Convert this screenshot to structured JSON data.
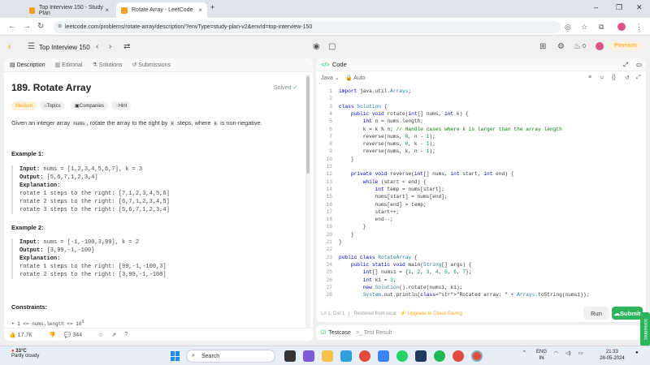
{
  "browser": {
    "tabs": [
      {
        "title": "Top Interview 150 - Study Plan",
        "close": "×"
      },
      {
        "title": "Rotate Array - LeetCode",
        "close": "×"
      }
    ],
    "new_tab": "+",
    "window_controls": [
      "–",
      "❐",
      "✕"
    ],
    "url": "leetcode.com/problems/rotate-array/description/?envType=study-plan-v2&envId=top-interview-150"
  },
  "lc_header": {
    "study_plan": "Top Interview 150",
    "streak": "0",
    "premium": "Premium"
  },
  "left_tabs": [
    {
      "label": "Description"
    },
    {
      "label": "Editorial"
    },
    {
      "label": "Solutions"
    },
    {
      "label": "Submissions"
    }
  ],
  "problem": {
    "title": "189. Rotate Array",
    "status": "Solved",
    "chips": [
      "Medium",
      "Topics",
      "Companies",
      "Hint"
    ],
    "desc_1": "Given an integer array ",
    "desc_nums": "nums",
    "desc_2": ", rotate the array to the right by ",
    "desc_k": "k",
    "desc_3": " steps, where ",
    "desc_k2": "k",
    "desc_4": " is non-negative."
  },
  "examples": [
    {
      "heading": "Example 1:",
      "input_label": "Input:",
      "input": " nums = [1,2,3,4,5,6,7], k = 3",
      "output_label": "Output:",
      "output": " [5,6,7,1,2,3,4]",
      "explanation_label": "Explanation:",
      "lines": [
        "rotate 1 steps to the right: [7,1,2,3,4,5,6]",
        "rotate 2 steps to the right: [6,7,1,2,3,4,5]",
        "rotate 3 steps to the right: [5,6,7,1,2,3,4]"
      ]
    },
    {
      "heading": "Example 2:",
      "input_label": "Input:",
      "input": " nums = [-1,-100,3,99], k = 2",
      "output_label": "Output:",
      "output": " [3,99,-1,-100]",
      "explanation_label": "Explanation:",
      "lines": [
        "rotate 1 steps to the right: [99,-1,-100,3]",
        "rotate 2 steps to the right: [3,99,-1,-100]"
      ]
    }
  ],
  "constraints": {
    "heading": "Constraints:",
    "first": "1 <= nums.length <= 10",
    "first_sup": "5"
  },
  "left_footer": {
    "likes": "17.7K",
    "comments": "344"
  },
  "code_panel": {
    "title": "Code",
    "language": "Java",
    "auto": "Auto",
    "cursor": "Ln 1, Col 1",
    "restored": "Restored from local",
    "upgrade": "Upgrade to Cloud Saving",
    "run": "Run",
    "submit": "Submit"
  },
  "code_lines": [
    "import java.util.Arrays;",
    "",
    "class Solution {",
    "    public void rotate(int[] nums, int k) {",
    "        int n = nums.length;",
    "        k = k % n; // Handle cases where k is larger than the array length",
    "        reverse(nums, 0, n - 1);",
    "        reverse(nums, 0, k - 1);",
    "        reverse(nums, k, n - 1);",
    "    }",
    "",
    "    private void reverse(int[] nums, int start, int end) {",
    "        while (start < end) {",
    "            int temp = nums[start];",
    "            nums[start] = nums[end];",
    "            nums[end] = temp;",
    "            start++;",
    "            end--;",
    "        }",
    "    }",
    "}",
    "",
    "public class RotateArray {",
    "    public static void main(String[] args) {",
    "        int[] nums1 = {1, 2, 3, 4, 5, 6, 7};",
    "        int k1 = 3;",
    "        new Solution().rotate(nums1, k1);",
    "        System.out.println(\"Rotated array: \" + Arrays.toString(nums1));"
  ],
  "testcase": {
    "label": "Testcase",
    "result": "Test Result"
  },
  "side_tag": "screenrec",
  "taskbar": {
    "temp": "33°C",
    "weather": "Partly cloudy",
    "search": "Search",
    "lang1": "ENG",
    "lang2": "IN",
    "time": "21:33",
    "date": "28-05-2024"
  }
}
